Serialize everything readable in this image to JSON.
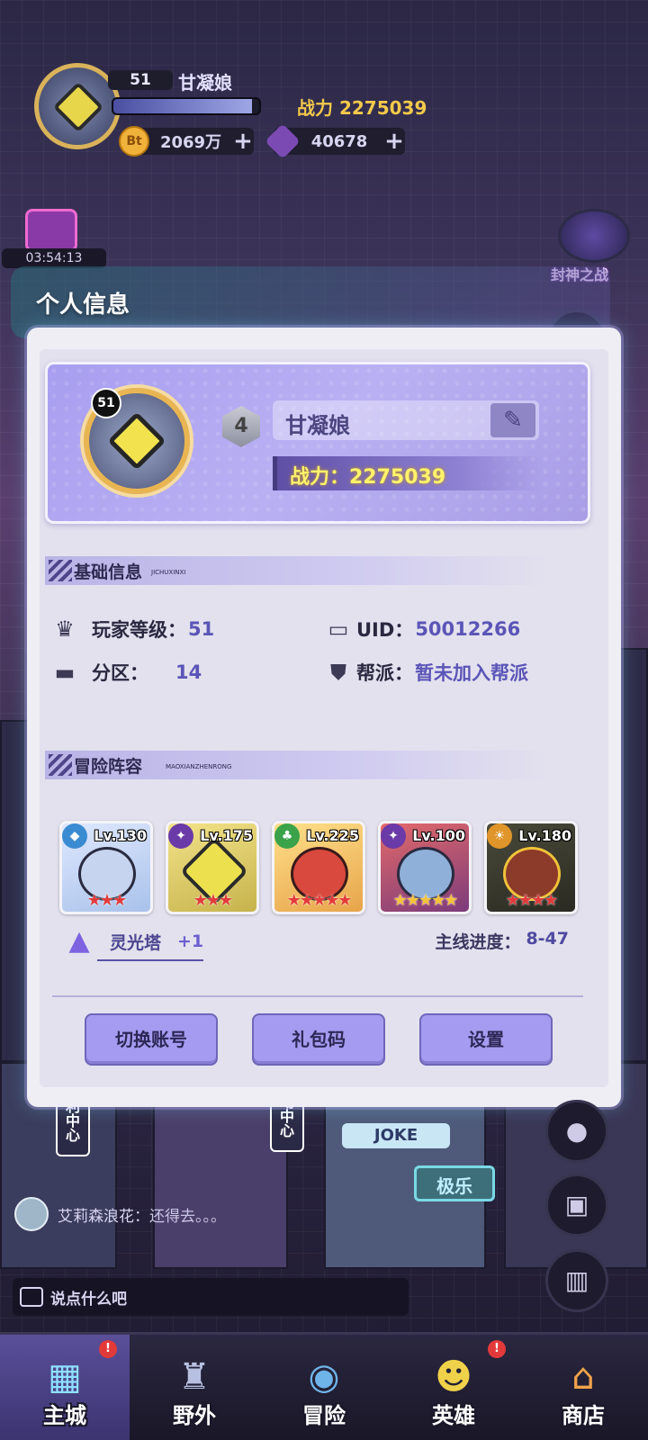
{
  "hud": {
    "level": "51",
    "name": "甘凝娘",
    "exp_fraction": 0.95,
    "power": "战力 2275039",
    "coins": "2069万",
    "gems": "40678",
    "plus": "+"
  },
  "timer": "03:54:13",
  "side": {
    "event_label": "封神之战"
  },
  "panel": {
    "title": "个人信息",
    "avatar_level": "51",
    "rank": "4",
    "name": "甘凝娘",
    "power": "战力：2275039",
    "basic": {
      "title": "基础信息",
      "pinyin": "JICHUXINXI",
      "level_label": "玩家等级：",
      "level_value": "51",
      "uid_label": "UID：",
      "uid_value": "50012266",
      "zone_label": "分区：",
      "zone_value": "14",
      "guild_label": "帮派：",
      "guild_value": "暂未加入帮派"
    },
    "lineup": {
      "title": "冒险阵容",
      "pinyin": "MAOXIANZHENRONG",
      "heroes": [
        {
          "level": "Lv.130",
          "stars": "★★★",
          "element": "water"
        },
        {
          "level": "Lv.175",
          "stars": "★★★",
          "element": "void"
        },
        {
          "level": "Lv.225",
          "stars": "★★★★★",
          "element": "nature"
        },
        {
          "level": "Lv.100",
          "stars": "★★★★★",
          "element": "void"
        },
        {
          "level": "Lv.180",
          "stars": "★★★★",
          "element": "light"
        }
      ],
      "tower_label": "灵光塔",
      "tower_plus": "+1",
      "mainline_label": "主线进度：",
      "mainline_value": "8-47"
    },
    "buttons": {
      "switch_account": "切换账号",
      "gift_code": "礼包码",
      "settings": "设置"
    }
  },
  "chat": {
    "sender": "艾莉森浪花：",
    "message": "还得去。。。",
    "placeholder": "说点什么吧"
  },
  "city_signs": {
    "joke": "JOKE",
    "jile": "极乐",
    "left": "利中心",
    "center": "动中心"
  },
  "nav": {
    "items": [
      {
        "label": "主城",
        "badge": "!"
      },
      {
        "label": "野外",
        "badge": ""
      },
      {
        "label": "冒险",
        "badge": ""
      },
      {
        "label": "英雄",
        "badge": "!"
      },
      {
        "label": "商店",
        "badge": ""
      }
    ]
  },
  "colors": {
    "accent": "#a59bf0",
    "power_gold": "#f3c94b",
    "value_purple": "#5b55b7"
  }
}
